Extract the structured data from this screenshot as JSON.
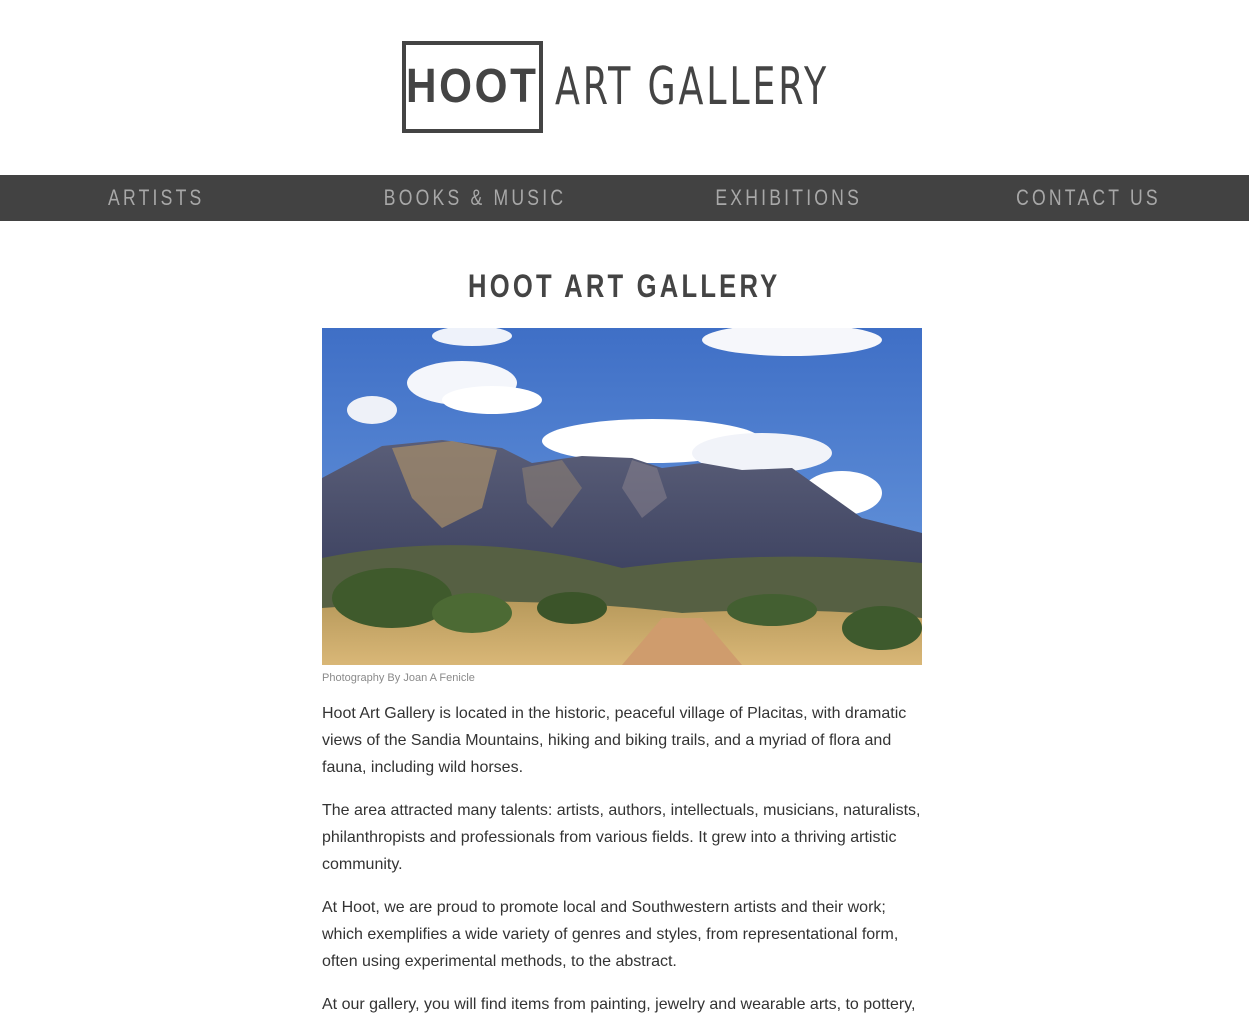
{
  "header": {
    "logo_box_text": "HOOT",
    "logo_text": "ART GALLERY"
  },
  "nav": {
    "items": [
      {
        "label": "ARTISTS"
      },
      {
        "label": "BOOKS & MUSIC"
      },
      {
        "label": "EXHIBITIONS"
      },
      {
        "label": "CONTACT US"
      }
    ]
  },
  "main": {
    "title": "HOOT ART GALLERY",
    "image_caption": "Photography By Joan A Fenicle",
    "paragraphs": [
      "Hoot Art Gallery is located in the historic, peaceful village of Placitas, with dramatic views of the Sandia Mountains, hiking and biking trails, and a myriad of flora and fauna, including wild horses.",
      "The area attracted many talents: artists, authors, intellectuals, musicians, naturalists, philanthropists and professionals from various fields. It grew into a thriving artistic community.",
      "At Hoot, we are proud to promote local and Southwestern artists and their work; which exemplifies a wide variety of genres and styles, from representational form, often using experimental methods, to the abstract.",
      "At our gallery, you will find items from painting, jewelry and wearable arts, to pottery,"
    ]
  },
  "colors": {
    "nav_background": "#424242",
    "nav_text": "#a8a8a8",
    "logo": "#444444",
    "body_text": "#333333"
  }
}
